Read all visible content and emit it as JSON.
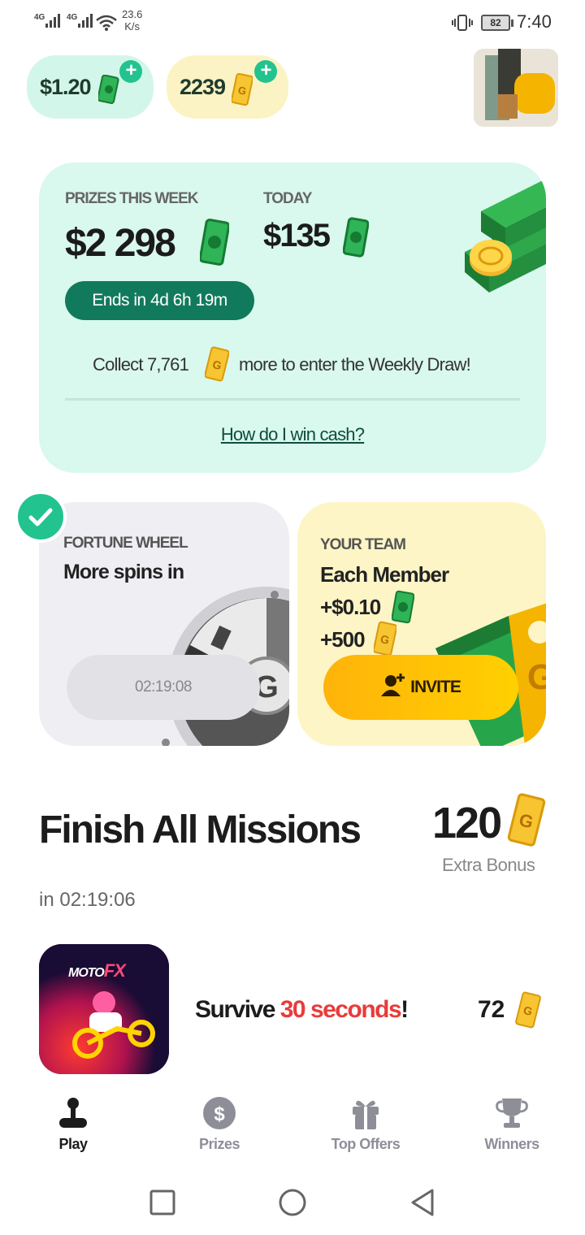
{
  "status_bar": {
    "network1": "4G",
    "network2": "4G",
    "speed_value": "23.6",
    "speed_unit": "K/s",
    "battery": "82",
    "time": "7:40"
  },
  "wallet": {
    "cash": "$1.20",
    "tickets": "2239",
    "add_symbol": "+"
  },
  "prize_card": {
    "week_label": "PRIZES THIS WEEK",
    "week_value": "$2 298",
    "today_label": "TODAY",
    "today_value": "$135",
    "ends_label": "Ends in 4d 6h 19m",
    "collect_prefix": "Collect 7,761",
    "collect_suffix": "more to enter the Weekly Draw!",
    "how_link": "How do I win cash?"
  },
  "fortune_wheel": {
    "label": "FORTUNE WHEEL",
    "title": "More spins in",
    "timer": "02:19:08"
  },
  "team": {
    "label": "YOUR TEAM",
    "title": "Each Member",
    "cash_reward": "+$0.10",
    "ticket_reward": "+500",
    "invite_label": "INVITE"
  },
  "missions": {
    "title": "Finish All Missions",
    "bonus_value": "120",
    "bonus_label": "Extra Bonus",
    "countdown": "in 02:19:06",
    "items": [
      {
        "game_logo_a": "MOTO",
        "game_logo_b": "FX",
        "text_a": "Survive ",
        "text_highlight": "30 seconds",
        "text_b": "!",
        "reward": "72"
      }
    ]
  },
  "bottom_nav": [
    {
      "label": "Play",
      "icon": "joystick-icon",
      "active": true
    },
    {
      "label": "Prizes",
      "icon": "dollar-coin-icon",
      "active": false
    },
    {
      "label": "Top Offers",
      "icon": "gift-icon",
      "active": false
    },
    {
      "label": "Winners",
      "icon": "trophy-icon",
      "active": false
    }
  ],
  "colors": {
    "accent_green": "#22c38f",
    "dark_green": "#127a5c",
    "highlight_red": "#e93b3b",
    "invite_yellow": "#ffc107"
  }
}
